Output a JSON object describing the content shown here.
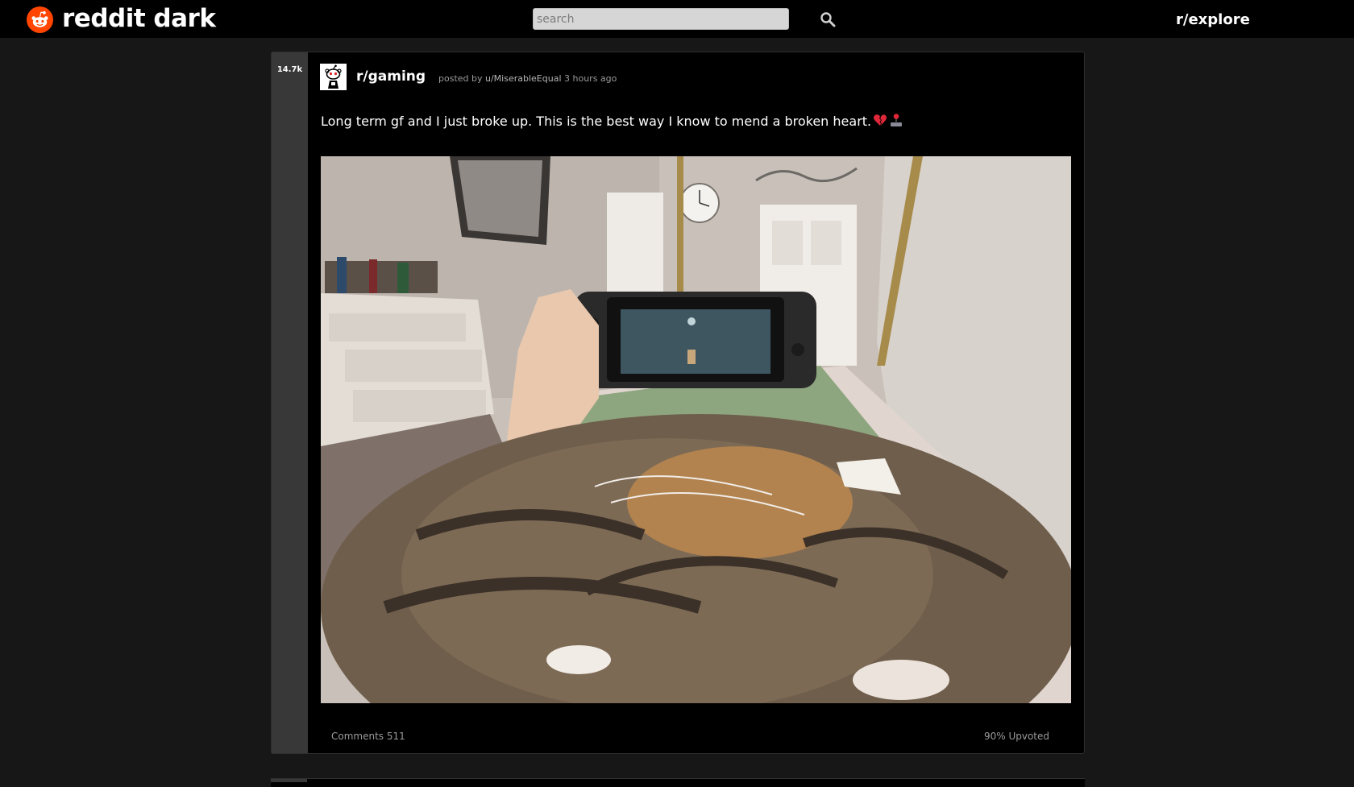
{
  "header": {
    "brand": "reddit dark",
    "logo_icon": "reddit-alien-icon",
    "search_placeholder": "search",
    "search_icon": "search-icon",
    "explore_link": "r/explore"
  },
  "post": {
    "score": "14.7k",
    "subreddit": "r/gaming",
    "meta_prefix": "posted by",
    "author": "u/MiserableEqual",
    "time": "3 hours ago",
    "title": "Long term gf and I just broke up. This is the best way I know to mend a broken heart.",
    "title_emojis": [
      "broken-heart-emoji",
      "joystick-emoji"
    ],
    "comments": "Comments 511",
    "upvoted": "90% Upvoted"
  },
  "colors": {
    "background": "#171717",
    "topbar": "#000000",
    "post_bg": "#000000",
    "vote_column": "#383838",
    "logo": "#ff4500",
    "meta_text": "#9a9a9a"
  }
}
